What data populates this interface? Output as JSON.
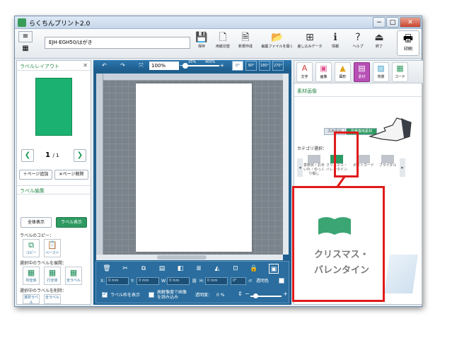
{
  "app": {
    "title": "らくちんプリント2.0"
  },
  "window_buttons": {
    "minimize": "−",
    "maximize": "□",
    "close": "✕"
  },
  "toolbar": {
    "printer": "EJH-EGH50/はがき",
    "tools": [
      {
        "label": "保存",
        "icon": "save-icon",
        "glyph": "💾"
      },
      {
        "label": "用紙切替",
        "icon": "paper-switch-icon",
        "glyph": "🗋"
      },
      {
        "label": "新規作成",
        "icon": "new-file-icon",
        "glyph": "🗎"
      },
      {
        "label": "編集ファイルを開く",
        "icon": "open-file-icon",
        "glyph": "📂"
      },
      {
        "label": "差し込みデータ",
        "icon": "merge-data-icon",
        "glyph": "⊞"
      },
      {
        "label": "情報",
        "icon": "info-icon",
        "glyph": "ℹ"
      },
      {
        "label": "ヘルプ",
        "icon": "help-icon",
        "glyph": "?"
      },
      {
        "label": "終了",
        "icon": "exit-icon",
        "glyph": "⏏"
      }
    ],
    "print_label": "印刷"
  },
  "left_panel": {
    "title": "ラベルレイアウト",
    "page_current": "1",
    "page_total": "/ 1",
    "add_page": "＋ページ追加",
    "delete_page": "✕ページ削除",
    "edit_section": "ラベル編集",
    "view_all": "全体表示",
    "view_label": "ラベル表示",
    "copy_label": "ラベルのコピー：",
    "copy_btn": "コピー",
    "paste_btn": "ペースト",
    "expand_label": "選択中のラベルを展開：",
    "expand_buttons": [
      "列全体",
      "行全体",
      "全ラベル"
    ],
    "delete_label": "選択中のラベルを削除：",
    "delete_buttons": [
      "選択ラベル",
      "全ラベル"
    ]
  },
  "canvas": {
    "zoom": "100%",
    "zoom_marks": [
      "25%",
      "400%"
    ],
    "rotations": [
      "0°",
      "90°",
      "180°",
      "270°"
    ]
  },
  "controls": {
    "x_label": "X:",
    "x_value": "0 mm",
    "y_label": "Y:",
    "y_value": "0 mm",
    "w_label": "W:",
    "w_value": "0 mm",
    "h_label": "H:",
    "h_value": "0 mm",
    "angle": "0°",
    "transparent": "透明色",
    "show_frame": "ラベル枠を表示",
    "hires": "高解像度で画像を読み込み",
    "opacity_label": "透明度：",
    "opacity_value": "0 %"
  },
  "right_panel": {
    "tabs": [
      {
        "label": "文字",
        "glyph": "A",
        "icon": "text-tab-icon"
      },
      {
        "label": "画像",
        "glyph": "▣",
        "icon": "image-tab-icon"
      },
      {
        "label": "図形",
        "glyph": "▲",
        "icon": "shape-tab-icon"
      },
      {
        "label": "素材",
        "glyph": "▤",
        "icon": "material-tab-icon"
      },
      {
        "label": "背景",
        "glyph": "▨",
        "icon": "background-tab-icon"
      },
      {
        "label": "コード",
        "glyph": "▦",
        "icon": "barcode-tab-icon"
      }
    ],
    "heading": "素材画像",
    "segment_general": "汎用素材",
    "segment_special": "型番専用素材",
    "category_label": "カテゴリ選択：",
    "categories": [
      "季節状・お手いれ・ゆっくり暇し",
      "クリスマス・バレンタイン",
      "ポストカード",
      "ブライダル"
    ]
  },
  "callout": {
    "text": "クリスマス・バレンタイン"
  },
  "colors": {
    "accent_green": "#2e9a61",
    "canvas_blue": "#1f5f8f",
    "highlight_red": "#e01a1a",
    "active_tab": "#b74fb5"
  }
}
